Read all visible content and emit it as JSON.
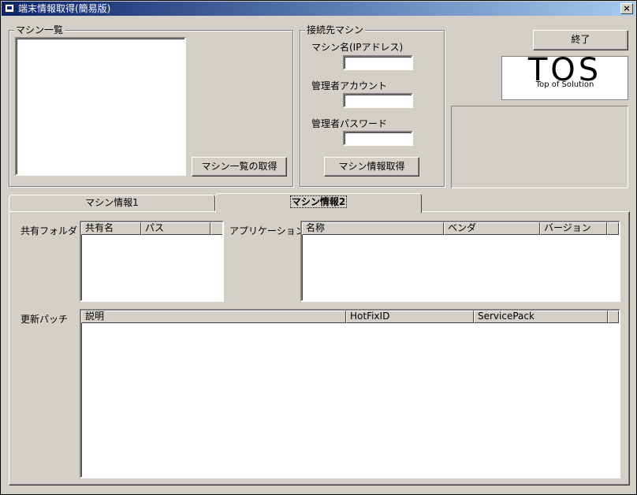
{
  "window": {
    "title": "端末情報取得(簡易版)",
    "close_symbol": "×"
  },
  "machine_list": {
    "group_label": "マシン一覧",
    "fetch_button": "マシン一覧の取得"
  },
  "connection": {
    "group_label": "接続先マシン",
    "machine_name_label": "マシン名(IPアドレス)",
    "machine_name_value": "",
    "admin_account_label": "管理者アカウント",
    "admin_account_value": "",
    "admin_password_label": "管理者パスワード",
    "admin_password_value": "",
    "fetch_info_button": "マシン情報取得"
  },
  "exit_button": "終了",
  "logo": {
    "main": "TOS",
    "sub": "Top of Solution"
  },
  "tabs": [
    {
      "label": "マシン情報1",
      "active": false
    },
    {
      "label": "マシン情報2",
      "active": true
    }
  ],
  "shared_folders": {
    "label": "共有フォルダ",
    "columns": [
      "共有名",
      "パス",
      ""
    ]
  },
  "applications": {
    "label": "アプリケーション",
    "columns": [
      "名称",
      "ベンダ",
      "バージョン",
      ""
    ]
  },
  "patches": {
    "label": "更新パッチ",
    "columns": [
      "説明",
      "HotFixID",
      "ServicePack",
      ""
    ]
  }
}
